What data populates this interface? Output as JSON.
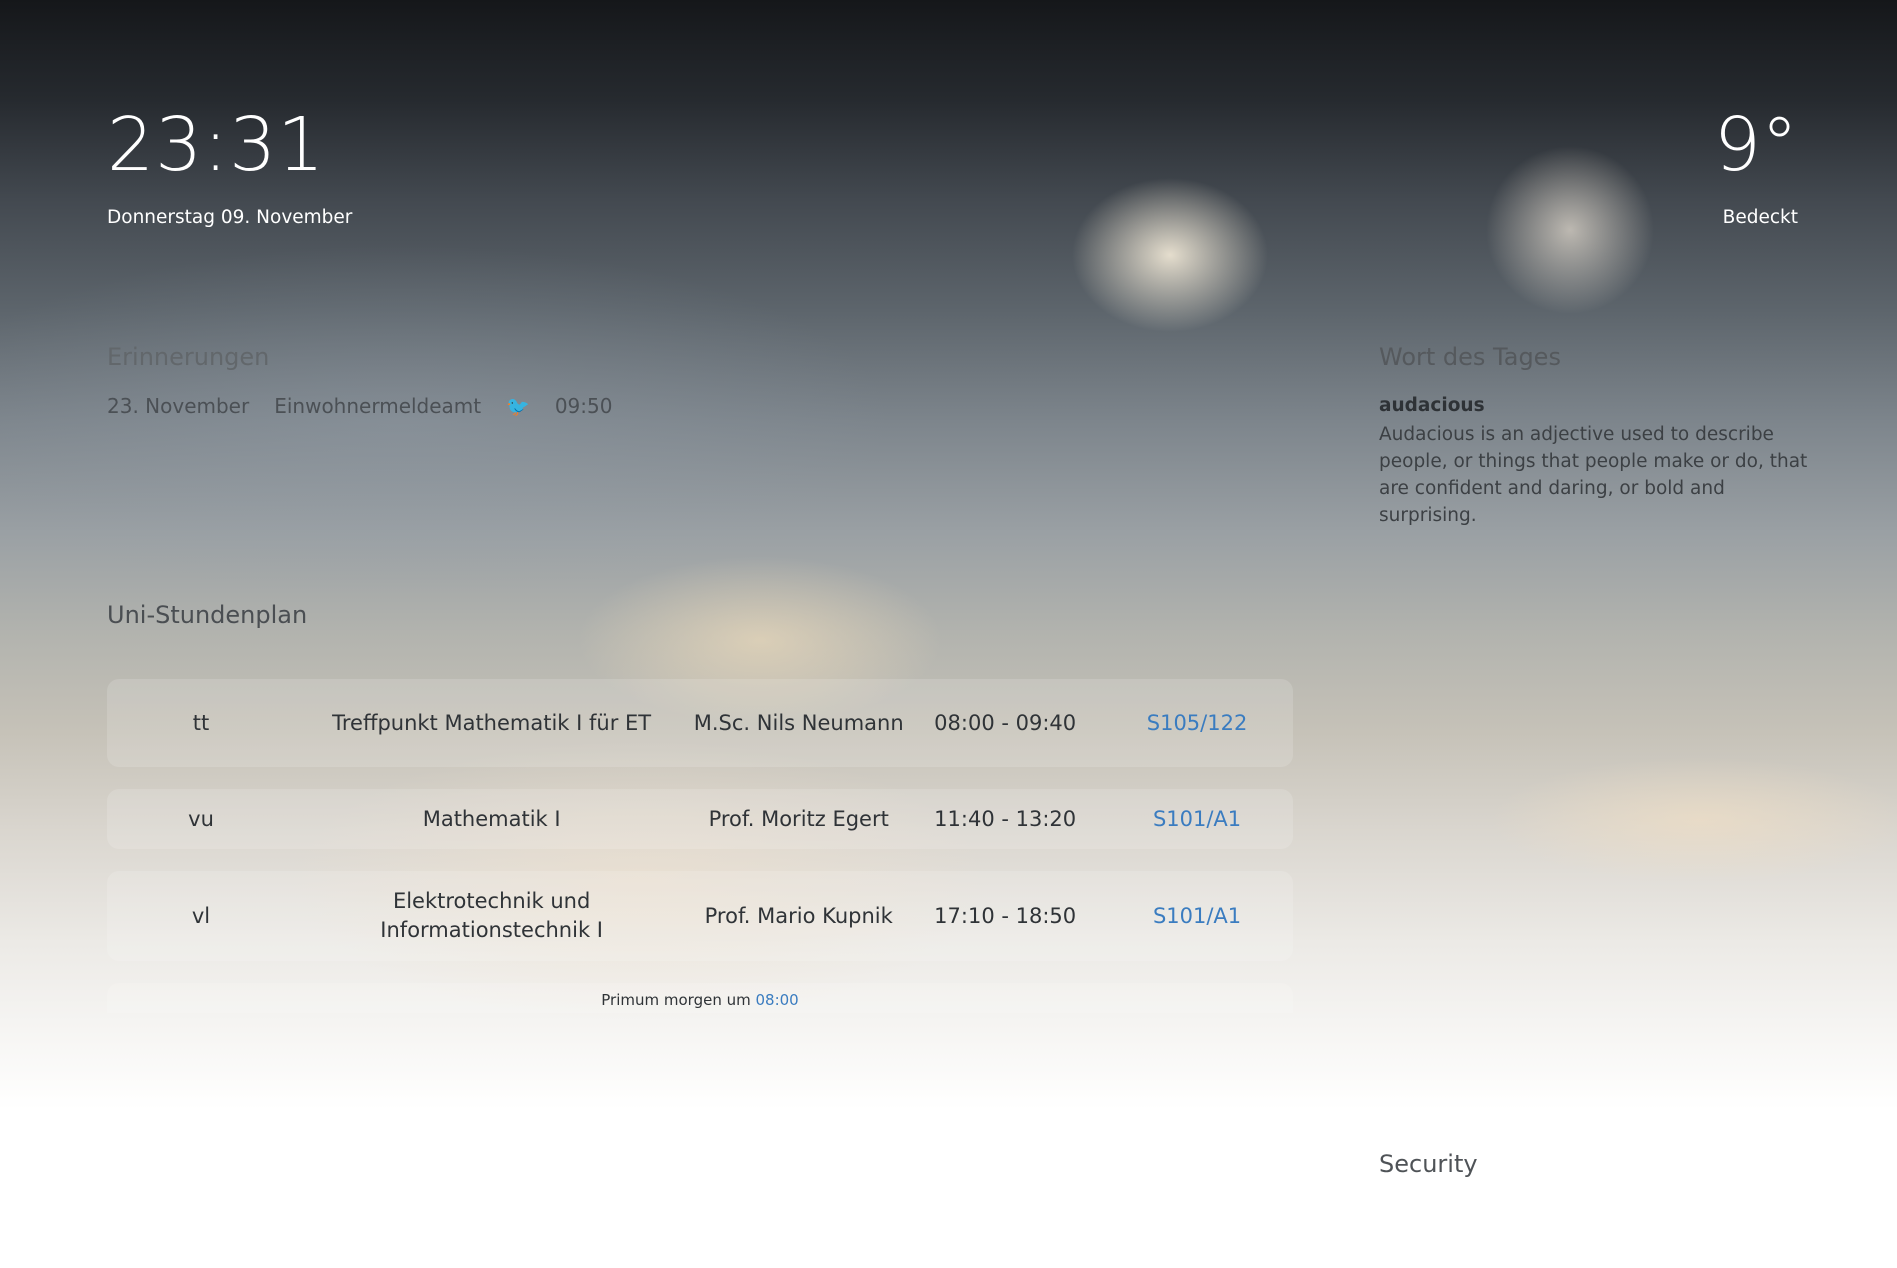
{
  "clock": {
    "time": "23:31",
    "date": "Donnerstag 09. November"
  },
  "weather": {
    "temperature": "9°",
    "condition": "Bedeckt"
  },
  "reminders": {
    "title": "Erinnerungen",
    "items": [
      {
        "date": "23. November",
        "label": "Einwohnermeldeamt",
        "icon": "bird-icon",
        "time": "09:50"
      }
    ]
  },
  "word_of_day": {
    "title": "Wort des Tages",
    "term": "audacious",
    "definition": "Audacious is an adjective used to describe people, or things that people make or do, that are confident and daring, or bold and surprising."
  },
  "schedule": {
    "title": "Uni-Stundenplan",
    "rows": [
      {
        "type": "tt",
        "course": "Treffpunkt Mathematik I für ET",
        "teacher": "M.Sc. Nils Neumann",
        "time": "08:00 - 09:40",
        "room": "S105/122"
      },
      {
        "type": "vu",
        "course": "Mathematik I",
        "teacher": "Prof. Moritz Egert",
        "time": "11:40 - 13:20",
        "room": "S101/A1"
      },
      {
        "type": "vl",
        "course": "Elektrotechnik und Informationstechnik I",
        "teacher": "Prof. Mario Kupnik",
        "time": "17:10 - 18:50",
        "room": "S101/A1"
      }
    ],
    "primum_text": "Primum morgen um",
    "primum_time": "08:00"
  },
  "security": {
    "title": "Security"
  },
  "colors": {
    "accent_link": "#3a7cc0",
    "bird_icon": "#1da1f2"
  }
}
